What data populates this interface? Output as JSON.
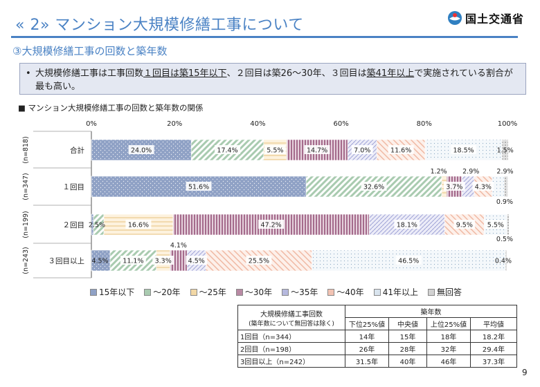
{
  "header": {
    "title": "« 2» マンション大規模修繕工事について",
    "ministry": "国土交通省",
    "subtitle": "③大規模修繕工事の回数と築年数"
  },
  "summary": {
    "bullet": "•",
    "part1": "大規模修繕工事は工事回数",
    "u1": "１回目は築15年以下",
    "part2": "、２回目は築26～30年、３回目は",
    "u2": "築41年以上",
    "part3": "で実施されている割合が最も高い。"
  },
  "chart_title": "■ マンション大規模修繕工事の回数と築年数の関係",
  "chart_data": {
    "type": "bar",
    "orientation": "horizontal",
    "stacked": true,
    "xlim": [
      0,
      100
    ],
    "xticks": [
      "0%",
      "20%",
      "40%",
      "60%",
      "80%",
      "100%"
    ],
    "categories": [
      "合計",
      "１回目",
      "２回目",
      "３回目以上"
    ],
    "n_labels": [
      "(n=818)",
      "(n=347)",
      "(n=199)",
      "(n=243)"
    ],
    "series": [
      {
        "name": "15年以下",
        "values": [
          24.0,
          51.6,
          0.5,
          4.5
        ]
      },
      {
        "name": "～20年",
        "values": [
          17.4,
          32.6,
          2.5,
          11.1
        ]
      },
      {
        "name": "～25年",
        "values": [
          5.5,
          1.2,
          16.6,
          3.3
        ]
      },
      {
        "name": "～30年",
        "values": [
          14.7,
          3.7,
          47.2,
          4.1
        ]
      },
      {
        "name": "～35年",
        "values": [
          7.0,
          2.9,
          18.1,
          4.5
        ]
      },
      {
        "name": "～40年",
        "values": [
          11.6,
          4.3,
          9.5,
          25.5
        ]
      },
      {
        "name": "41年以上",
        "values": [
          18.5,
          2.9,
          5.5,
          46.5
        ]
      },
      {
        "name": "無回答",
        "values": [
          1.5,
          0.9,
          0.5,
          0.4
        ]
      }
    ],
    "data_labels": [
      [
        "24.0%",
        "17.4%",
        "5.5%",
        "14.7%",
        "7.0%",
        "11.6%",
        "18.5%",
        "1.5%"
      ],
      [
        "51.6%",
        "32.6%",
        "1.2%",
        "3.7%",
        "2.9%",
        "4.3%",
        "2.9%",
        "0.9%"
      ],
      [
        "0.5%",
        "2.5%",
        "16.6%",
        "47.2%",
        "18.1%",
        "9.5%",
        "5.5%",
        "0.5%"
      ],
      [
        "4.5%",
        "11.1%",
        "3.3%",
        "4.1%",
        "4.5%",
        "25.5%",
        "46.5%",
        "0.4%"
      ]
    ],
    "colors": [
      "#8fa1c5",
      "#a9cbb0",
      "#f2d8a6",
      "#b98aa4",
      "#b6b9de",
      "#f2c3b3",
      "#d9e4ee",
      "#d2d2d2"
    ],
    "legend_position": "bottom"
  },
  "stats_table": {
    "header_col1_line1": "大規模修繕工事回数",
    "header_col1_line2": "(築年数について無回答は除く)",
    "header_group": "築年数",
    "subheaders": [
      "下位25%値",
      "中央値",
      "上位25%値",
      "平均値"
    ],
    "rows": [
      {
        "label": "1回目（n=344）",
        "cells": [
          "14年",
          "15年",
          "18年",
          "18.2年"
        ]
      },
      {
        "label": "2回目（n=198）",
        "cells": [
          "26年",
          "28年",
          "32年",
          "29.4年"
        ]
      },
      {
        "label": "3回目以上（n=242）",
        "cells": [
          "31.5年",
          "40年",
          "46年",
          "37.3年"
        ]
      }
    ]
  },
  "page_number": "9"
}
